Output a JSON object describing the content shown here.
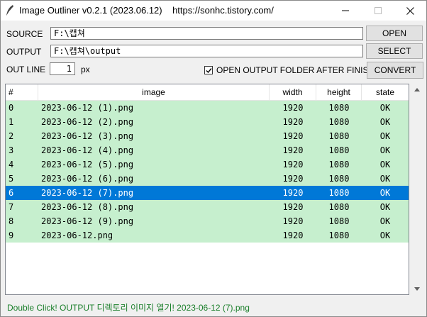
{
  "window": {
    "title": "Image Outliner v0.2.1 (2023.06.12)    https://sonhc.tistory.com/"
  },
  "form": {
    "source_label": "SOURCE",
    "source_value": "F:\\캡쳐",
    "output_label": "OUTPUT",
    "output_value": "F:\\캡쳐\\output",
    "outline_label": "OUT LINE",
    "outline_value": "1",
    "outline_unit": "px",
    "open_folder_label": "OPEN OUTPUT FOLDER AFTER FINISH",
    "open_folder_checked": true
  },
  "buttons": {
    "open": "OPEN",
    "select": "SELECT",
    "convert": "CONVERT"
  },
  "table": {
    "columns": [
      "#",
      "image",
      "width",
      "height",
      "state"
    ],
    "selected_index": 6,
    "rows": [
      {
        "num": "0",
        "image": "2023-06-12 (1).png",
        "width": "1920",
        "height": "1080",
        "state": "OK"
      },
      {
        "num": "1",
        "image": "2023-06-12 (2).png",
        "width": "1920",
        "height": "1080",
        "state": "OK"
      },
      {
        "num": "2",
        "image": "2023-06-12 (3).png",
        "width": "1920",
        "height": "1080",
        "state": "OK"
      },
      {
        "num": "3",
        "image": "2023-06-12 (4).png",
        "width": "1920",
        "height": "1080",
        "state": "OK"
      },
      {
        "num": "4",
        "image": "2023-06-12 (5).png",
        "width": "1920",
        "height": "1080",
        "state": "OK"
      },
      {
        "num": "5",
        "image": "2023-06-12 (6).png",
        "width": "1920",
        "height": "1080",
        "state": "OK"
      },
      {
        "num": "6",
        "image": "2023-06-12 (7).png",
        "width": "1920",
        "height": "1080",
        "state": "OK"
      },
      {
        "num": "7",
        "image": "2023-06-12 (8).png",
        "width": "1920",
        "height": "1080",
        "state": "OK"
      },
      {
        "num": "8",
        "image": "2023-06-12 (9).png",
        "width": "1920",
        "height": "1080",
        "state": "OK"
      },
      {
        "num": "9",
        "image": "2023-06-12.png",
        "width": "1920",
        "height": "1080",
        "state": "OK"
      }
    ]
  },
  "status": {
    "text": "Double Click!  OUTPUT 디렉토리 이미지 열기!  2023-06-12 (7).png"
  },
  "colors": {
    "row_ok": "#c6efce",
    "row_selected": "#0078d7",
    "status_text": "#1a7f2a"
  },
  "icons": {
    "app": "feather-quill-icon",
    "minimize": "minimize-icon",
    "maximize": "maximize-icon",
    "close": "close-icon",
    "check": "check-icon",
    "scroll_up": "chevron-up-icon",
    "scroll_down": "chevron-down-icon"
  }
}
